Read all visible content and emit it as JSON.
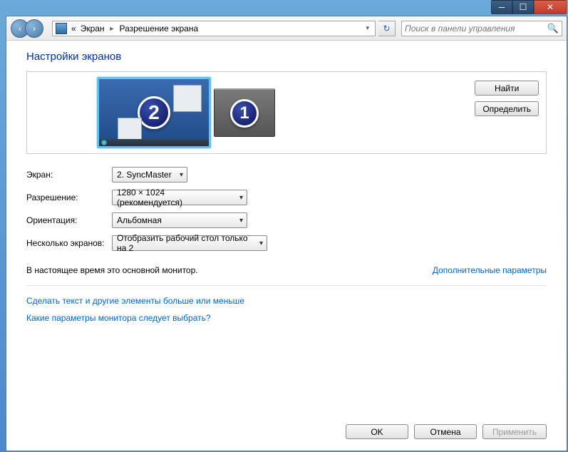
{
  "window_controls": {
    "minimize": "_",
    "maximize": "☐",
    "close": "✕"
  },
  "nav": {
    "back": "◄",
    "forward": "►",
    "prefix": "«",
    "crumb1": "Экран",
    "sep": "►",
    "crumb2": "Разрешение экрана",
    "refresh": "↻",
    "search_placeholder": "Поиск в панели управления",
    "search_icon": "🔍"
  },
  "page_title": "Настройки экранов",
  "monitors": {
    "primary": "2",
    "secondary": "1"
  },
  "preview_buttons": {
    "find": "Найти",
    "identify": "Определить"
  },
  "form": {
    "display_label": "Экран:",
    "display_value": "2. SyncMaster",
    "resolution_label": "Разрешение:",
    "resolution_value": "1280 × 1024 (рекомендуется)",
    "orientation_label": "Ориентация:",
    "orientation_value": "Альбомная",
    "multi_label": "Несколько экранов:",
    "multi_value": "Отобразить рабочий стол только на 2"
  },
  "info": {
    "main_monitor": "В настоящее время это основной монитор.",
    "advanced_link": "Дополнительные параметры"
  },
  "links": {
    "text_size": "Сделать текст и другие элементы больше или меньше",
    "which_settings": "Какие параметры монитора следует выбрать?"
  },
  "actions": {
    "ok": "OK",
    "cancel": "Отмена",
    "apply": "Применить"
  }
}
